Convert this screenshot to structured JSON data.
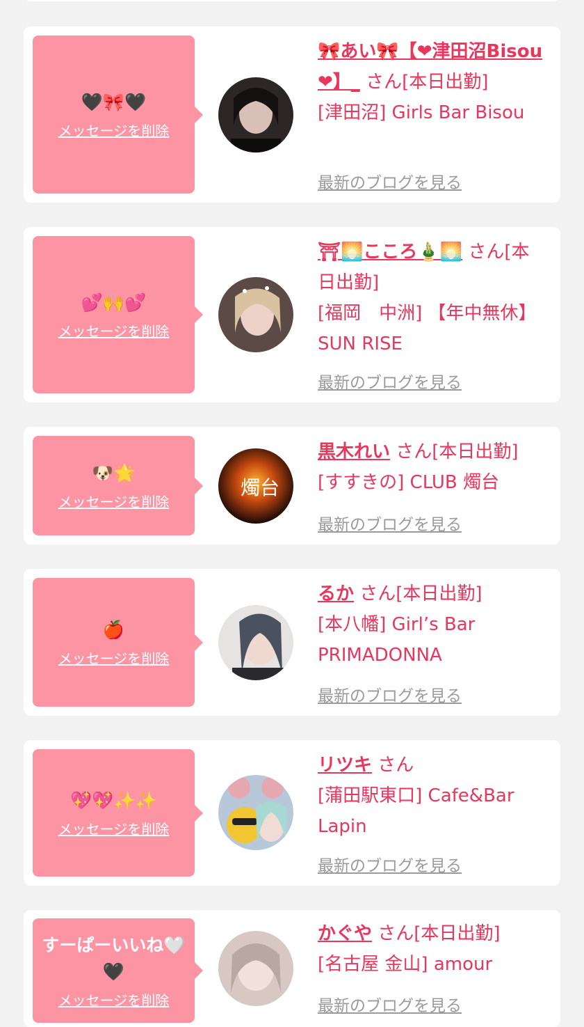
{
  "common": {
    "delete_label": "メッセージを削除",
    "blog_label": "最新のブログを見る"
  },
  "cards": [
    {
      "message": "🖤🎀🖤",
      "name": "🎀あい🎀【❤津田沼Bisou❤】_",
      "suffix": "さん[本日出勤]",
      "shop": "[津田沼] Girls Bar Bisou",
      "avatar_color": "#3a3434"
    },
    {
      "message": "💕🙌💕",
      "name": "⛩🌅こころ🎍🌅",
      "suffix": "さん[本日出勤]",
      "shop": "[福岡　中洲] 【年中無休】SUN RISE",
      "avatar_color": "#c7a9a0"
    },
    {
      "message": "🐶🌟",
      "name": "黒木れい",
      "suffix": "さん[本日出勤]",
      "shop": "[すすきの] CLUB 燭台",
      "avatar_color": "#7a2a10",
      "avatar_text": "燭台"
    },
    {
      "message": "🍎",
      "name": "るか",
      "suffix": "さん[本日出勤]",
      "shop": "[本八幡] Girl’s Bar PRIMADONNA",
      "avatar_color": "#5a606a"
    },
    {
      "message": "💖💖✨✨",
      "name": "リツキ",
      "suffix": "さん",
      "shop": "[蒲田駅東口] Cafe&Bar Lapin",
      "avatar_color": "#8aa0b8"
    },
    {
      "message": "すーぱーいいね🤍🖤",
      "name": "かぐや",
      "suffix": "さん[本日出勤]",
      "shop": "[名古屋 金山] amour",
      "avatar_color": "#c8b4b0"
    }
  ]
}
